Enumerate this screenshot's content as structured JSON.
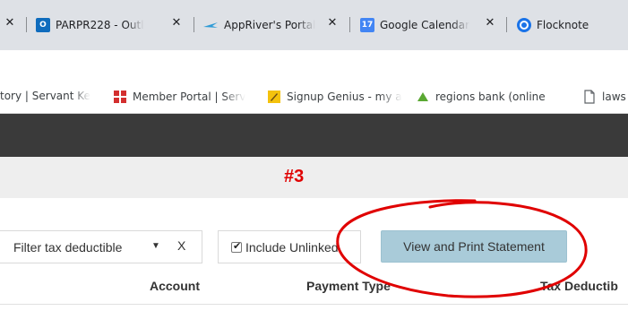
{
  "browser": {
    "tabs": [
      {
        "label": "",
        "icon": "",
        "has_close": true
      },
      {
        "label": "PARPR228 - Outl",
        "icon": "outlook-icon",
        "icon_color": "#0f6cbd",
        "has_close": true
      },
      {
        "label": "AppRiver's Portal",
        "icon": "appriver-icon",
        "icon_color": "#2f9bd6",
        "has_close": true
      },
      {
        "label": "Google Calendar",
        "icon": "calendar-icon",
        "icon_color": "#4285f4",
        "icon_text": "17",
        "has_close": true
      },
      {
        "label": "Flocknote",
        "icon": "flocknote-icon",
        "icon_color": "#1a73e8",
        "has_close": false
      }
    ],
    "close_glyph": "✕",
    "bookmarks": [
      {
        "label": "tory | Servant Ke",
        "icon": ""
      },
      {
        "label": "Member Portal | Serv",
        "icon": "member-portal-icon",
        "icon_color": "#d32f2f"
      },
      {
        "label": "Signup Genius - my a",
        "icon": "signup-genius-icon",
        "icon_color": "#f4c20d"
      },
      {
        "label": "regions bank (online",
        "icon": "regions-bank-icon",
        "icon_color": "#5aa832"
      },
      {
        "label": "laws",
        "icon": "page-icon"
      }
    ]
  },
  "annotation": {
    "label": "#3",
    "color": "#e00000"
  },
  "toolbar": {
    "filter_label": "Filter tax deductible",
    "filter_arrow": "▼",
    "filter_clear": "X",
    "include_unlinked_label": "Include Unlinked",
    "include_unlinked_checked": true,
    "view_print_label": "View and Print Statement",
    "view_print_color": "#a9cbd9"
  },
  "table": {
    "columns": [
      "Account",
      "Payment Type",
      "Tax Deductib"
    ]
  }
}
